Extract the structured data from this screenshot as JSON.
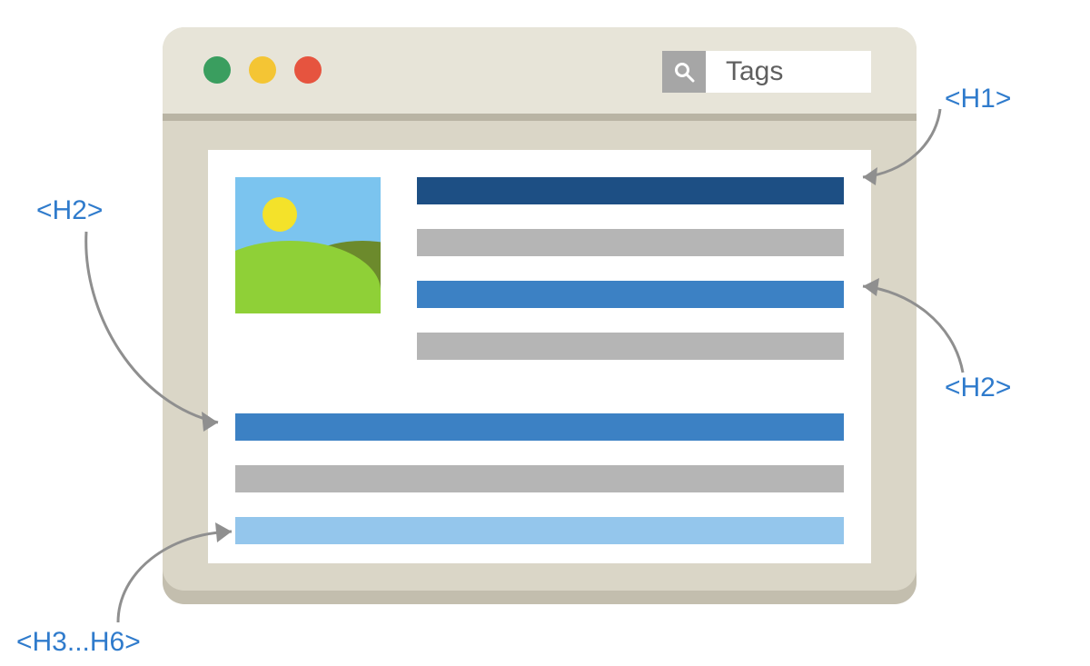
{
  "search": {
    "label": "Tags"
  },
  "annotations": {
    "h1": "<H1>",
    "h2_left": "<H2>",
    "h2_right": "<H2>",
    "h3h6": "<H3...H6>"
  },
  "heading_bars": [
    {
      "level": "h1",
      "color": "#1d4f84"
    },
    {
      "level": "text",
      "color": "#b5b5b5"
    },
    {
      "level": "h2",
      "color": "#3c81c4"
    },
    {
      "level": "text",
      "color": "#b5b5b5"
    },
    {
      "level": "h2",
      "color": "#3c81c4"
    },
    {
      "level": "text",
      "color": "#b5b5b5"
    },
    {
      "level": "h3",
      "color": "#94c6ec"
    }
  ]
}
